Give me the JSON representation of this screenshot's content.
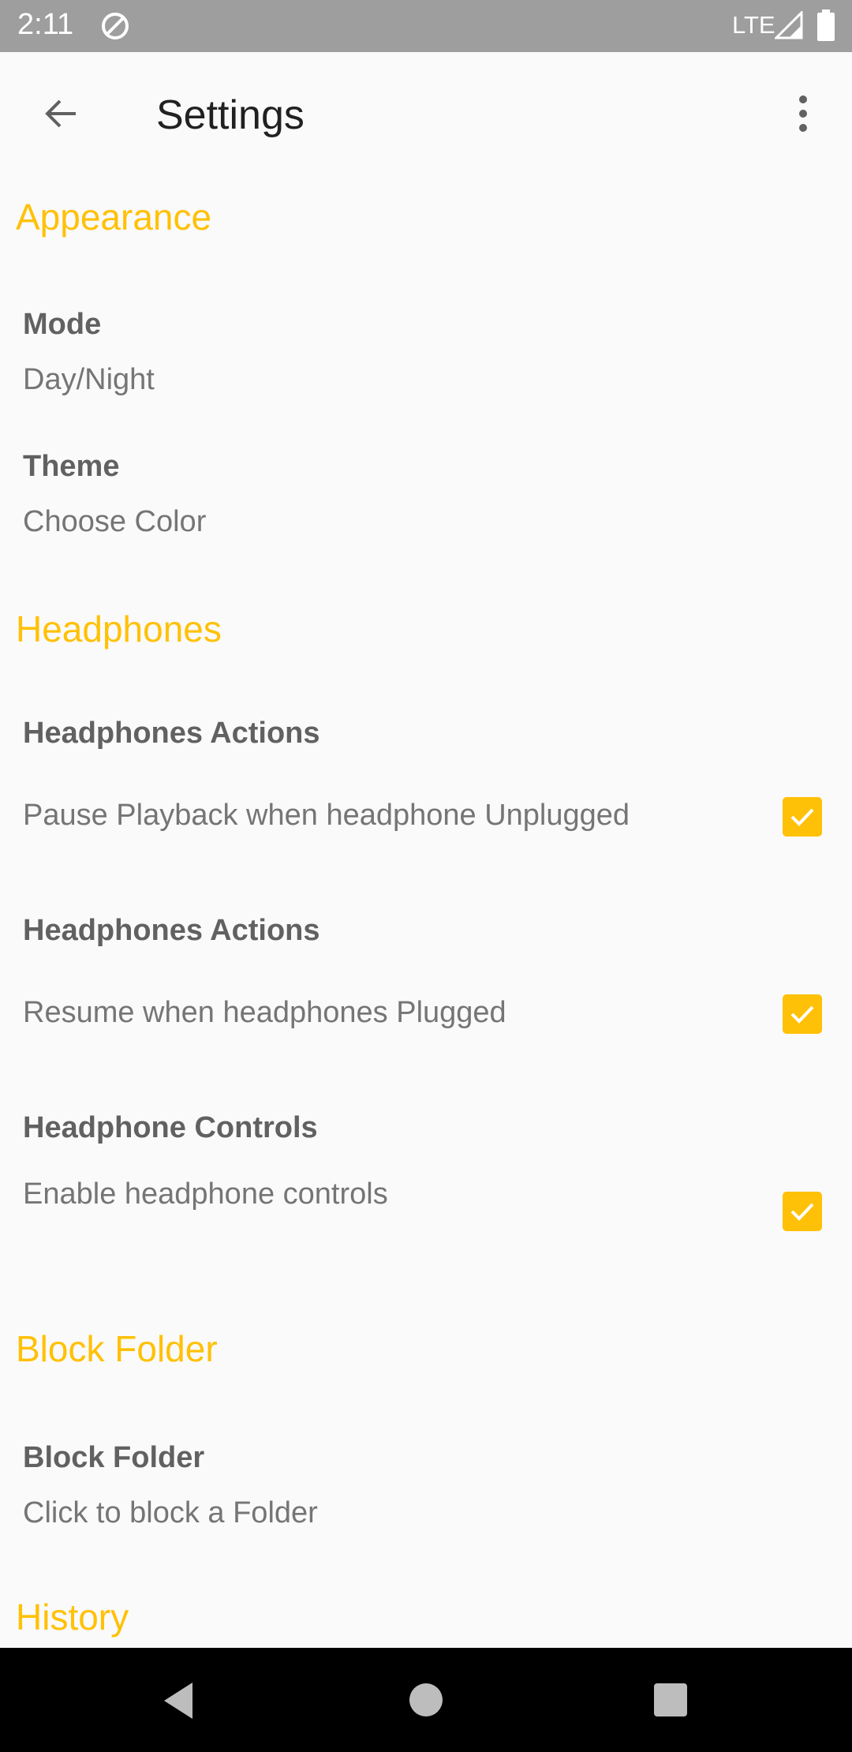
{
  "status_bar": {
    "time": "2:11",
    "network": "LTE",
    "icons": [
      "do-not-disturb-icon",
      "signal-icon",
      "battery-icon"
    ]
  },
  "toolbar": {
    "title": "Settings",
    "back_icon": "arrow-back-icon",
    "more_icon": "more-vert-icon"
  },
  "sections": {
    "appearance": {
      "header": "Appearance",
      "mode": {
        "title": "Mode",
        "summary": "Day/Night"
      },
      "theme": {
        "title": "Theme",
        "summary": "Choose Color"
      }
    },
    "headphones": {
      "header": "Headphones",
      "pause": {
        "title": "Headphones Actions",
        "summary": "Pause Playback when headphone Unplugged",
        "checked": true
      },
      "resume": {
        "title": "Headphones Actions",
        "summary": "Resume when headphones Plugged",
        "checked": true
      },
      "controls": {
        "title": "Headphone Controls",
        "summary": "Enable headphone controls",
        "checked": true
      }
    },
    "block_folder": {
      "header": "Block Folder",
      "block": {
        "title": "Block Folder",
        "summary": "Click to block a Folder"
      }
    },
    "history": {
      "header": "History"
    }
  },
  "colors": {
    "accent": "#ffc107",
    "status_bar": "#9e9e9e",
    "background": "#fafafa",
    "nav_bar": "#000000"
  }
}
